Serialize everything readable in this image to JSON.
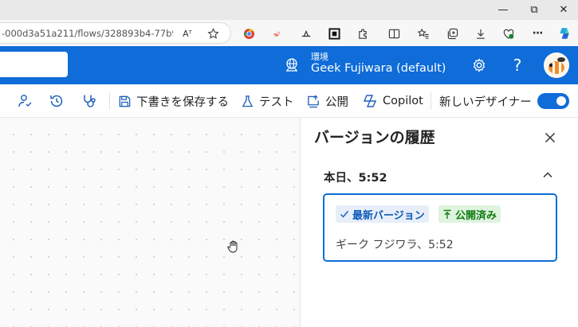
{
  "browser": {
    "url": "-000d3a51a211/flows/328893b4-77b9-4...",
    "read_aloud_label": "Aᵀ",
    "minimize_glyph": "—",
    "restore_glyph": "⧉",
    "close_glyph": "✕",
    "more_glyph": "···"
  },
  "header": {
    "environment_label": "環境",
    "environment_name": "Geek Fujiwara (default)",
    "help_glyph": "?"
  },
  "commandbar": {
    "save_draft_label": "下書きを保存する",
    "test_label": "テスト",
    "publish_label": "公開",
    "copilot_label": "Copilot",
    "new_designer_label": "新しいデザイナー",
    "new_designer_on": true
  },
  "panel": {
    "title": "バージョンの履歴",
    "group_label": "本日、5:52",
    "version": {
      "latest_badge": "最新バージョン",
      "published_badge": "公開済み",
      "meta": "ギーク フジワラ、5:52"
    }
  },
  "colors": {
    "brand": "#0f6cd8",
    "published": "#107c10",
    "latest": "#0f5cb8"
  }
}
